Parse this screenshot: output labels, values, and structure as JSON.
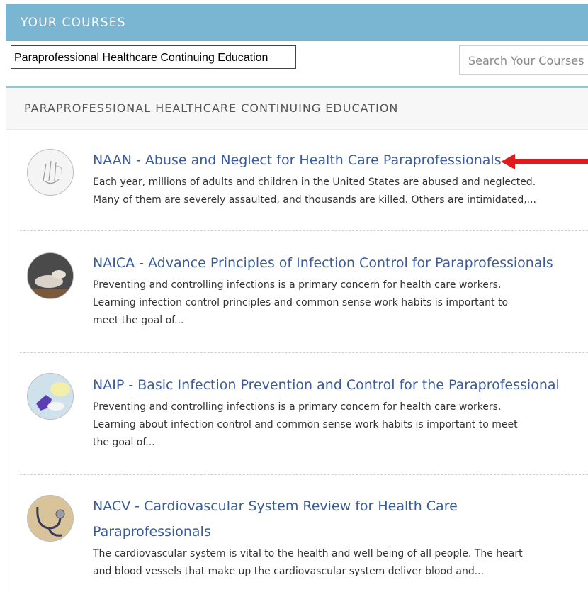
{
  "header": {
    "title": "YOUR COURSES"
  },
  "filter": {
    "selected_category": "Paraprofessional Healthcare Continuing Education",
    "search_placeholder": "Search Your Courses"
  },
  "section": {
    "title": "PARAPROFESSIONAL HEALTHCARE CONTINUING EDUCATION"
  },
  "courses": [
    {
      "title": "NAAN - Abuse and Neglect for Health Care Paraprofessionals",
      "description": [
        "Each year, millions of adults and children in the United States are abused and neglected.",
        "Many of them are severely assaulted, and thousands are killed. Others are intimidated,..."
      ]
    },
    {
      "title": "NAICA - Advance Principles of Infection Control for Paraprofessionals",
      "description": [
        "Preventing and controlling infections is a primary concern for health care workers.",
        "Learning infection control principles and common sense work habits is important to",
        "meet the goal of..."
      ]
    },
    {
      "title": "NAIP - Basic Infection Prevention and Control for the Paraprofessional",
      "description": [
        "Preventing and controlling infections is a primary concern for health care workers.",
        "Learning about infection control and common sense work habits is important to meet",
        "the goal of..."
      ]
    },
    {
      "title_lines": [
        "NACV - Cardiovascular System Review for Health Care",
        "Paraprofessionals"
      ],
      "description": [
        "The cardiovascular system is vital to the health and well being of all people. The heart",
        "and blood vessels that make up the cardiovascular system deliver blood and..."
      ]
    }
  ],
  "colors": {
    "header_bg": "#7ab6d2",
    "link": "#3b5c9a",
    "arrow": "#e01b1b"
  }
}
